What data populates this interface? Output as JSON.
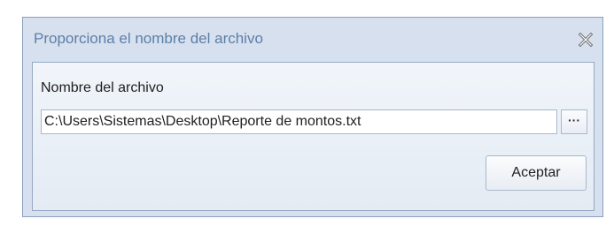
{
  "dialog": {
    "title": "Proporciona el nombre del archivo",
    "close_icon": "close-icon",
    "field_label": "Nombre del archivo",
    "path_value": "C:\\Users\\Sistemas\\Desktop\\Reporte de montos.txt",
    "browse_label": "···",
    "accept_label": "Aceptar"
  },
  "colors": {
    "title_text": "#5d7fa8",
    "frame_border": "#8ba0bc",
    "frame_background": "#d6e0ee",
    "content_background": "#eef3f9"
  }
}
